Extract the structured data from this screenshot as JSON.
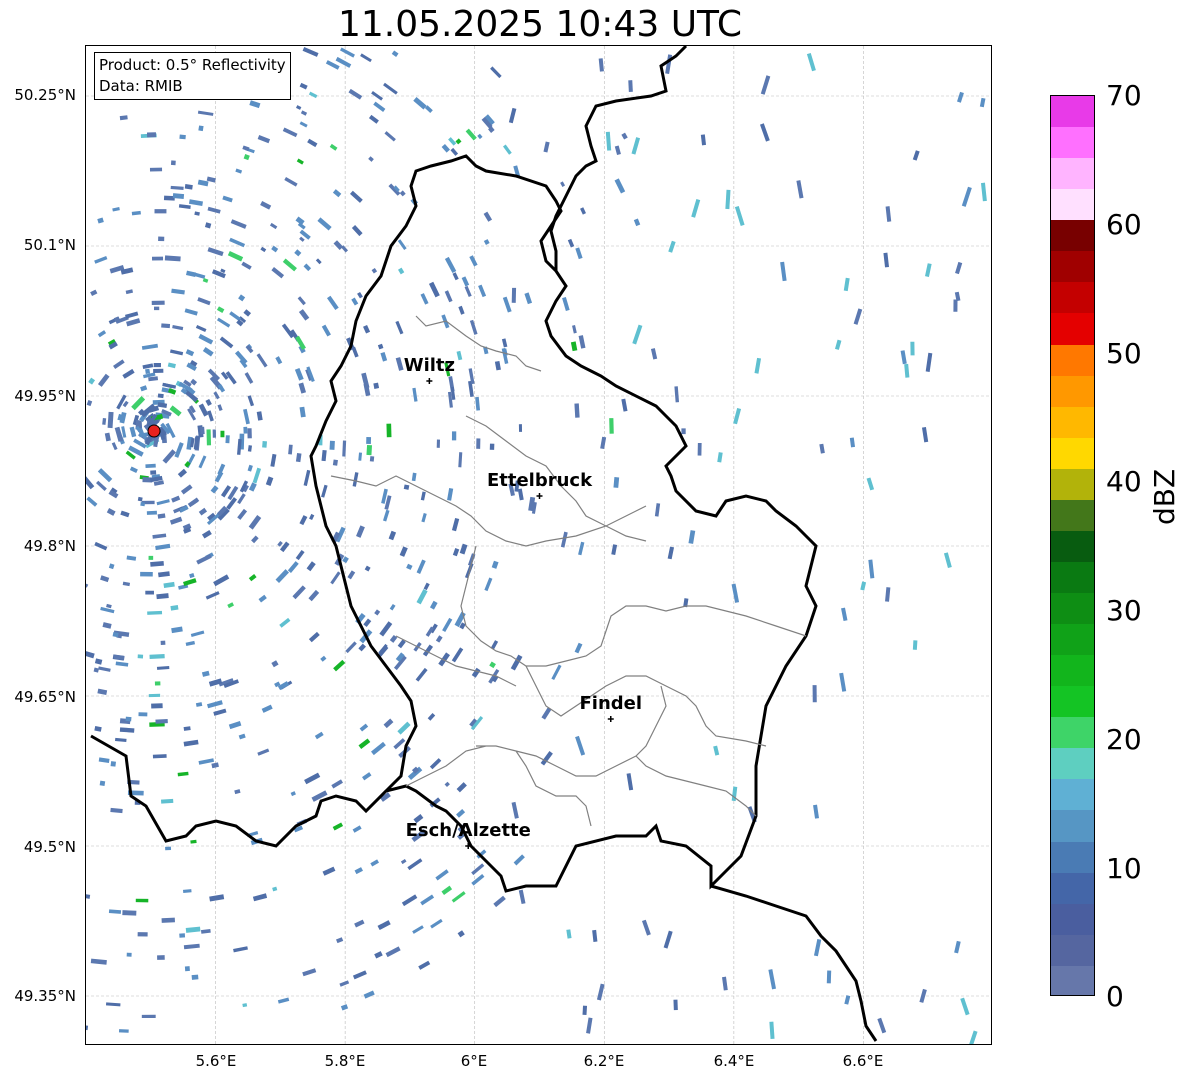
{
  "title": "11.05.2025 10:43 UTC",
  "info": {
    "product": "Product: 0.5° Reflectivity",
    "data": "Data: RMIB"
  },
  "axes": {
    "y_ticks": [
      "50.25°N",
      "50.1°N",
      "49.95°N",
      "49.8°N",
      "49.65°N",
      "49.5°N",
      "49.35°N"
    ],
    "x_ticks": [
      "5.6°E",
      "5.8°E",
      "6°E",
      "6.2°E",
      "6.4°E",
      "6.6°E"
    ]
  },
  "cities": [
    {
      "name": "Wiltz",
      "lon": 5.93,
      "lat": 49.965
    },
    {
      "name": "Ettelbruck",
      "lon": 6.1,
      "lat": 49.85
    },
    {
      "name": "Findel",
      "lon": 6.21,
      "lat": 49.627
    },
    {
      "name": "Esch/Alzette",
      "lon": 5.99,
      "lat": 49.5
    }
  ],
  "radar_site": {
    "lon": 5.505,
    "lat": 49.915,
    "color": "#e8221e"
  },
  "colorbar": {
    "label": "dBZ",
    "min": 0,
    "max": 70,
    "ticks": [
      "70",
      "60",
      "50",
      "40",
      "30",
      "20",
      "10",
      "0"
    ],
    "colors": [
      "#6677aa",
      "#5566a0",
      "#4a5e9f",
      "#4466a8",
      "#4a7bb4",
      "#5696c4",
      "#5fb0d4",
      "#5ecfc0",
      "#3ed468",
      "#14c424",
      "#12b51c",
      "#10a218",
      "#0e8e14",
      "#0a7a12",
      "#085c10",
      "#43771a",
      "#b2b30a",
      "#ffd800",
      "#ffb800",
      "#ff9800",
      "#ff7800",
      "#e40000",
      "#c40000",
      "#a00000",
      "#780000",
      "#ffe0ff",
      "#ffb4ff",
      "#ff70ff",
      "#e83ae8"
    ]
  }
}
